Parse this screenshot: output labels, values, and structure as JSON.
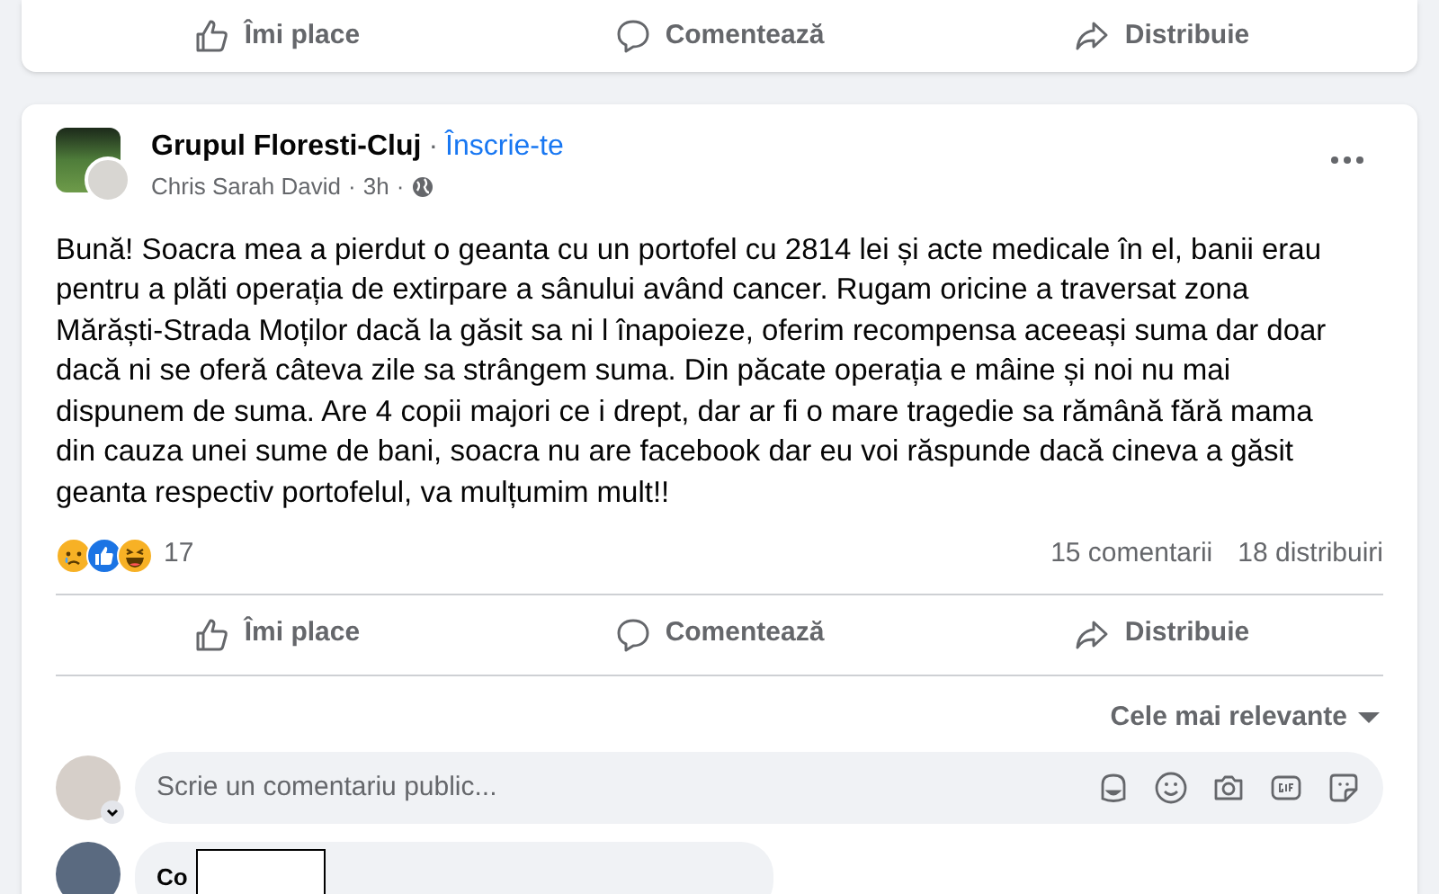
{
  "previous_post": {
    "actions": [
      {
        "kind": "like",
        "label": "Îmi place"
      },
      {
        "kind": "comment",
        "label": "Comentează"
      },
      {
        "kind": "share",
        "label": "Distribuie"
      }
    ]
  },
  "post": {
    "group": "Grupul Floresti-Cluj",
    "header_separator": "·",
    "join_link": "Înscrie-te",
    "author": "Chris Sarah David",
    "meta_separators": [
      "·",
      "·"
    ],
    "time": "3h",
    "text": "Bună! Soacra mea a pierdut o geanta cu un portofel cu 2814 lei și acte medicale în el, banii erau pentru a plăti operația de extirpare a sânului având cancer. Rugam oricine a traversat zona Mărăști-Strada Moților dacă la găsit sa ni l înapoieze, oferim recompensa aceeași suma dar doar dacă ni se oferă câteva zile sa strângem suma. Din păcate operația e mâine și noi nu mai dispunem de suma. Are 4 copii majori ce i drept, dar ar fi o mare tragedie sa rămână fără mama din cauza unei sume de bani, soacra nu are facebook dar eu voi răspunde dacă cineva a găsit geanta respectiv portofelul, va mulțumim mult!!",
    "reactions": [
      {
        "kind": "sad"
      },
      {
        "kind": "like"
      },
      {
        "kind": "haha"
      }
    ],
    "reaction_count": "17",
    "comments": "15 comentarii",
    "shares": "18 distribuiri",
    "actions": [
      {
        "kind": "like",
        "label": "Îmi place"
      },
      {
        "kind": "comment",
        "label": "Comentează"
      },
      {
        "kind": "share",
        "label": "Distribuie"
      }
    ],
    "sort": "Cele mai relevante",
    "comment_box": {
      "placeholder": "Scrie un comentariu public...",
      "tools": [
        {
          "kind": "avatar"
        },
        {
          "kind": "emoji"
        },
        {
          "kind": "camera"
        },
        {
          "kind": "gif"
        },
        {
          "kind": "sticker"
        }
      ]
    },
    "first_comment": {
      "author": "Co"
    }
  }
}
